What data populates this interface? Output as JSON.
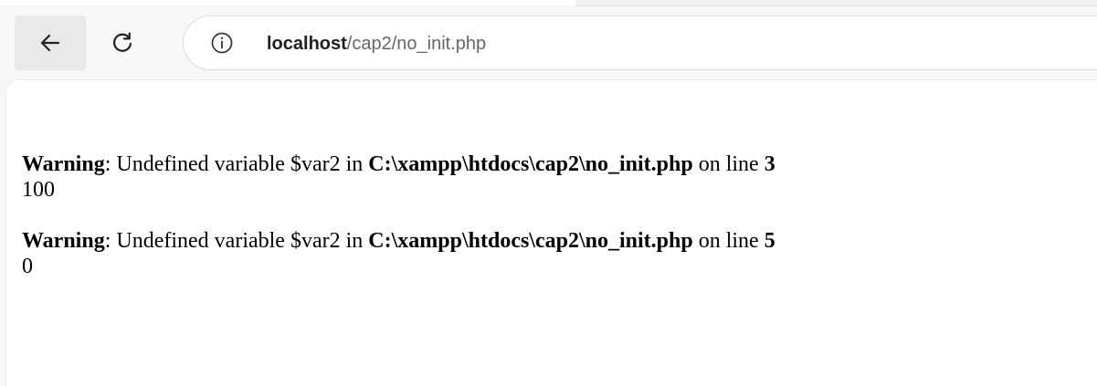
{
  "browser": {
    "icons": {
      "back": "arrow-left-icon",
      "reload": "reload-icon",
      "site_info": "info-icon"
    },
    "address": {
      "host": "localhost",
      "path": "/cap2/no_init.php"
    }
  },
  "page": {
    "warnings": [
      {
        "label": "Warning",
        "separator": ": ",
        "message": "Undefined variable $var2 in ",
        "file": "C:\\xampp\\htdocs\\cap2\\no_init.php",
        "on_line_text": " on line ",
        "line": "3"
      },
      {
        "label": "Warning",
        "separator": ": ",
        "message": "Undefined variable $var2 in ",
        "file": "C:\\xampp\\htdocs\\cap2\\no_init.php",
        "on_line_text": " on line ",
        "line": "5"
      }
    ],
    "outputs": [
      "100",
      "0"
    ]
  }
}
